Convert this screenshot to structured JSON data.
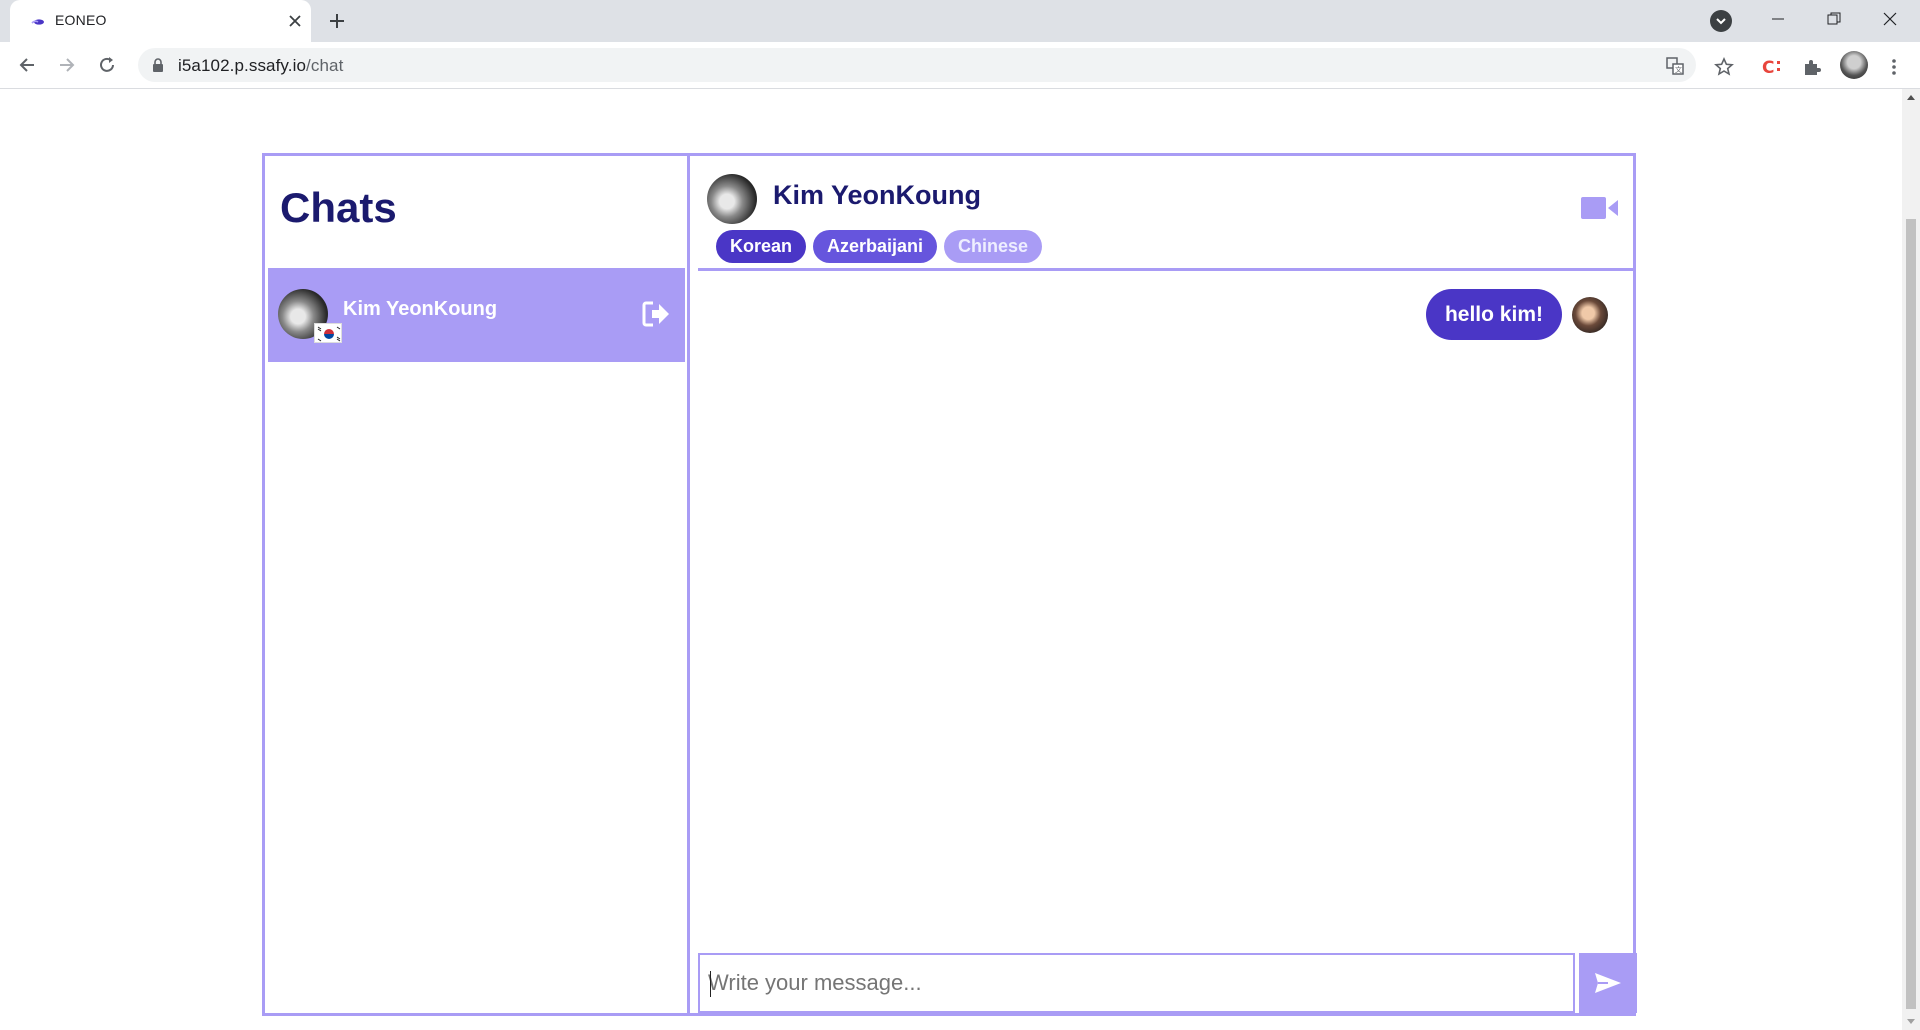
{
  "browser": {
    "tab_title": "EONEO",
    "url_host": "i5a102.p.ssafy.io",
    "url_path": "/chat"
  },
  "sidebar": {
    "title": "Chats",
    "items": [
      {
        "name": "Kim YeonKoung",
        "flag": "south-korea-flag-icon",
        "action_icon": "sign-out-icon"
      }
    ]
  },
  "conversation": {
    "contact_name": "Kim YeonKoung",
    "languages": [
      "Korean",
      "Azerbaijani",
      "Chinese"
    ],
    "messages": [
      {
        "text": "hello kim!",
        "from": "me"
      }
    ],
    "composer_placeholder": "Write your message...",
    "video_icon": "video-camera-icon",
    "send_icon": "paper-plane-icon"
  },
  "colors": {
    "accent_light": "#a99cf5",
    "accent_dark": "#4a36c6",
    "accent_mid": "#6655dd",
    "title_navy": "#1b1a6e"
  }
}
